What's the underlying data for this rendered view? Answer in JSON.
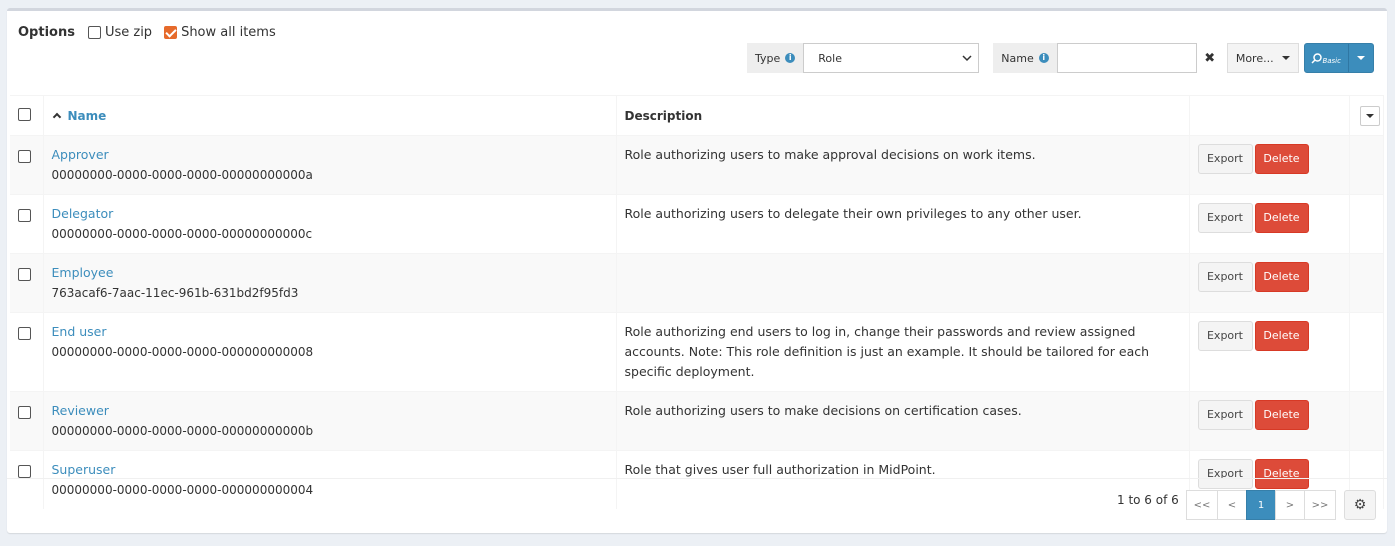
{
  "options": {
    "title": "Options",
    "use_zip": "Use zip",
    "show_all": "Show all items"
  },
  "search": {
    "type_label": "Type",
    "type_value": "Role",
    "name_label": "Name",
    "name_value": "",
    "clear": "✖",
    "more_label": "More...",
    "basic_label": "Basic"
  },
  "table": {
    "columns": [
      "Name",
      "Description"
    ],
    "export_label": "Export",
    "delete_label": "Delete",
    "rows": [
      {
        "name": "Approver",
        "oid": "00000000-0000-0000-0000-00000000000a",
        "description": "Role authorizing users to make approval decisions on work items."
      },
      {
        "name": "Delegator",
        "oid": "00000000-0000-0000-0000-00000000000c",
        "description": "Role authorizing users to delegate their own privileges to any other user."
      },
      {
        "name": "Employee",
        "oid": "763acaf6-7aac-11ec-961b-631bd2f95fd3",
        "description": ""
      },
      {
        "name": "End user",
        "oid": "00000000-0000-0000-0000-000000000008",
        "description": "Role authorizing end users to log in, change their passwords and review assigned accounts. Note: This role definition is just an example. It should be tailored for each specific deployment."
      },
      {
        "name": "Reviewer",
        "oid": "00000000-0000-0000-0000-00000000000b",
        "description": "Role authorizing users to make decisions on certification cases."
      },
      {
        "name": "Superuser",
        "oid": "00000000-0000-0000-0000-000000000004",
        "description": "Role that gives user full authorization in MidPoint."
      }
    ]
  },
  "footer": {
    "info": "1 to 6 of 6",
    "pager": [
      "<<",
      "<",
      "1",
      ">",
      ">>"
    ],
    "active_page": "1"
  },
  "colors": {
    "accent": "#3c8dbc",
    "danger": "#dd4b39",
    "checkbox_checked": "#e66a2b"
  }
}
